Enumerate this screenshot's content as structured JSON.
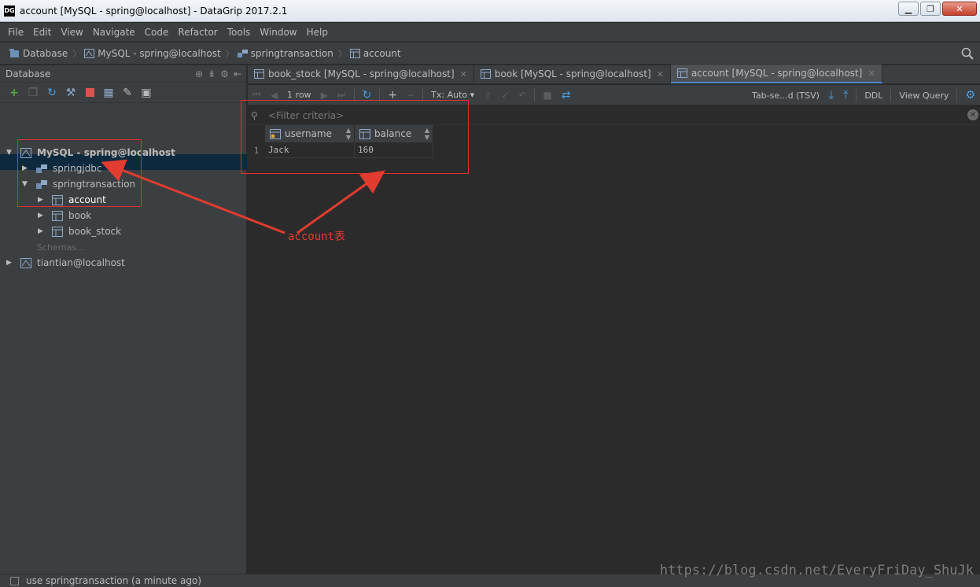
{
  "window": {
    "app_icon": "DG",
    "title": "account [MySQL - spring@localhost] - DataGrip 2017.2.1",
    "buttons": [
      "minimize",
      "restore",
      "close"
    ]
  },
  "menu": [
    "File",
    "Edit",
    "View",
    "Navigate",
    "Code",
    "Refactor",
    "Tools",
    "Window",
    "Help"
  ],
  "breadcrumb": [
    {
      "label": "Database",
      "icon": "database-icon"
    },
    {
      "label": "MySQL - spring@localhost",
      "icon": "mysql-icon"
    },
    {
      "label": "springtransaction",
      "icon": "schema-icon"
    },
    {
      "label": "account",
      "icon": "table-icon"
    }
  ],
  "left_panel": {
    "title": "Database",
    "tree": [
      {
        "label": "MySQL - spring@localhost",
        "level": 0,
        "expanded": true
      },
      {
        "label": "springjdbc",
        "level": 1,
        "expanded": false
      },
      {
        "label": "springtransaction",
        "level": 1,
        "expanded": true
      },
      {
        "label": "account",
        "level": 2,
        "selected": true
      },
      {
        "label": "book",
        "level": 2
      },
      {
        "label": "book_stock",
        "level": 2
      },
      {
        "label": "Schemas...",
        "level": 1
      },
      {
        "label": "tiantian@localhost",
        "level": 0,
        "expanded": false
      }
    ]
  },
  "tabs": [
    {
      "label": "book_stock [MySQL - spring@localhost]",
      "active": false
    },
    {
      "label": "book [MySQL - spring@localhost]",
      "active": false
    },
    {
      "label": "account [MySQL - spring@localhost]",
      "active": true
    }
  ],
  "data_toolbar": {
    "rows": "1 row",
    "tx": "Tx: Auto",
    "export_format": "Tab-se...d (TSV)",
    "ddl": "DDL",
    "view_query": "View Query"
  },
  "filter": {
    "placeholder": "<Filter criteria>"
  },
  "table": {
    "columns": [
      "username",
      "balance"
    ],
    "rows": [
      {
        "num": "1",
        "username": "Jack",
        "balance": "160"
      }
    ]
  },
  "annotation": {
    "text": "account表",
    "color": "#e23b30"
  },
  "status": {
    "message": "use springtransaction (a minute ago)"
  },
  "watermark": "https://blog.csdn.net/EveryFriDay_ShuJk"
}
